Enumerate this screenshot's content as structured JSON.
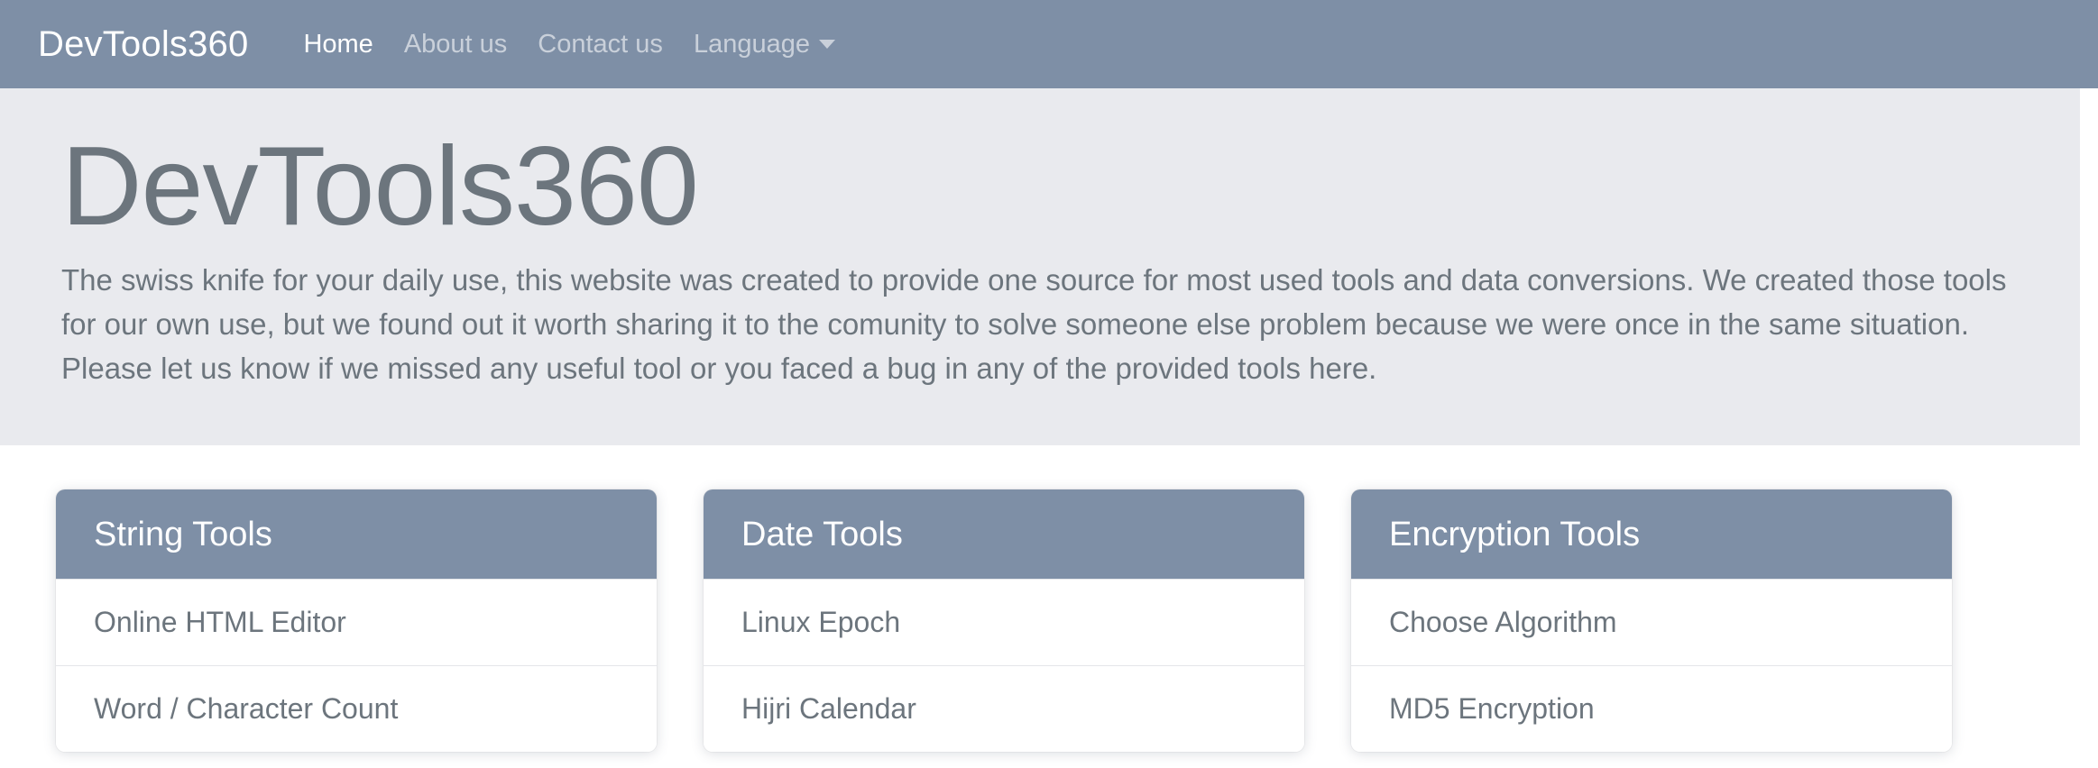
{
  "navbar": {
    "brand": "DevTools360",
    "links": [
      {
        "label": "Home",
        "active": true,
        "caret": false
      },
      {
        "label": "About us",
        "active": false,
        "caret": false
      },
      {
        "label": "Contact us",
        "active": false,
        "caret": false
      },
      {
        "label": "Language",
        "active": false,
        "caret": true
      }
    ]
  },
  "jumbotron": {
    "title": "DevTools360",
    "description": "The swiss knife for your daily use, this website was created to provide one source for most used tools and data conversions. We created those tools for our own use, but we found out it worth sharing it to the comunity to solve someone else problem because we were once in the same situation. Please let us know if we missed any useful tool or you faced a bug in any of the provided tools here."
  },
  "cards": [
    {
      "title": "String Tools",
      "items": [
        "Online HTML Editor",
        "Word / Character Count"
      ]
    },
    {
      "title": "Date Tools",
      "items": [
        "Linux Epoch",
        "Hijri Calendar"
      ]
    },
    {
      "title": "Encryption Tools",
      "items": [
        "Choose Algorithm",
        "MD5 Encryption"
      ]
    }
  ],
  "colors": {
    "navbar_bg": "#7e8fa6",
    "jumbotron_bg": "#e9eaee",
    "text_muted": "#6c757d",
    "card_header_bg": "#7e8fa6",
    "page_bg": "#ffffff"
  }
}
